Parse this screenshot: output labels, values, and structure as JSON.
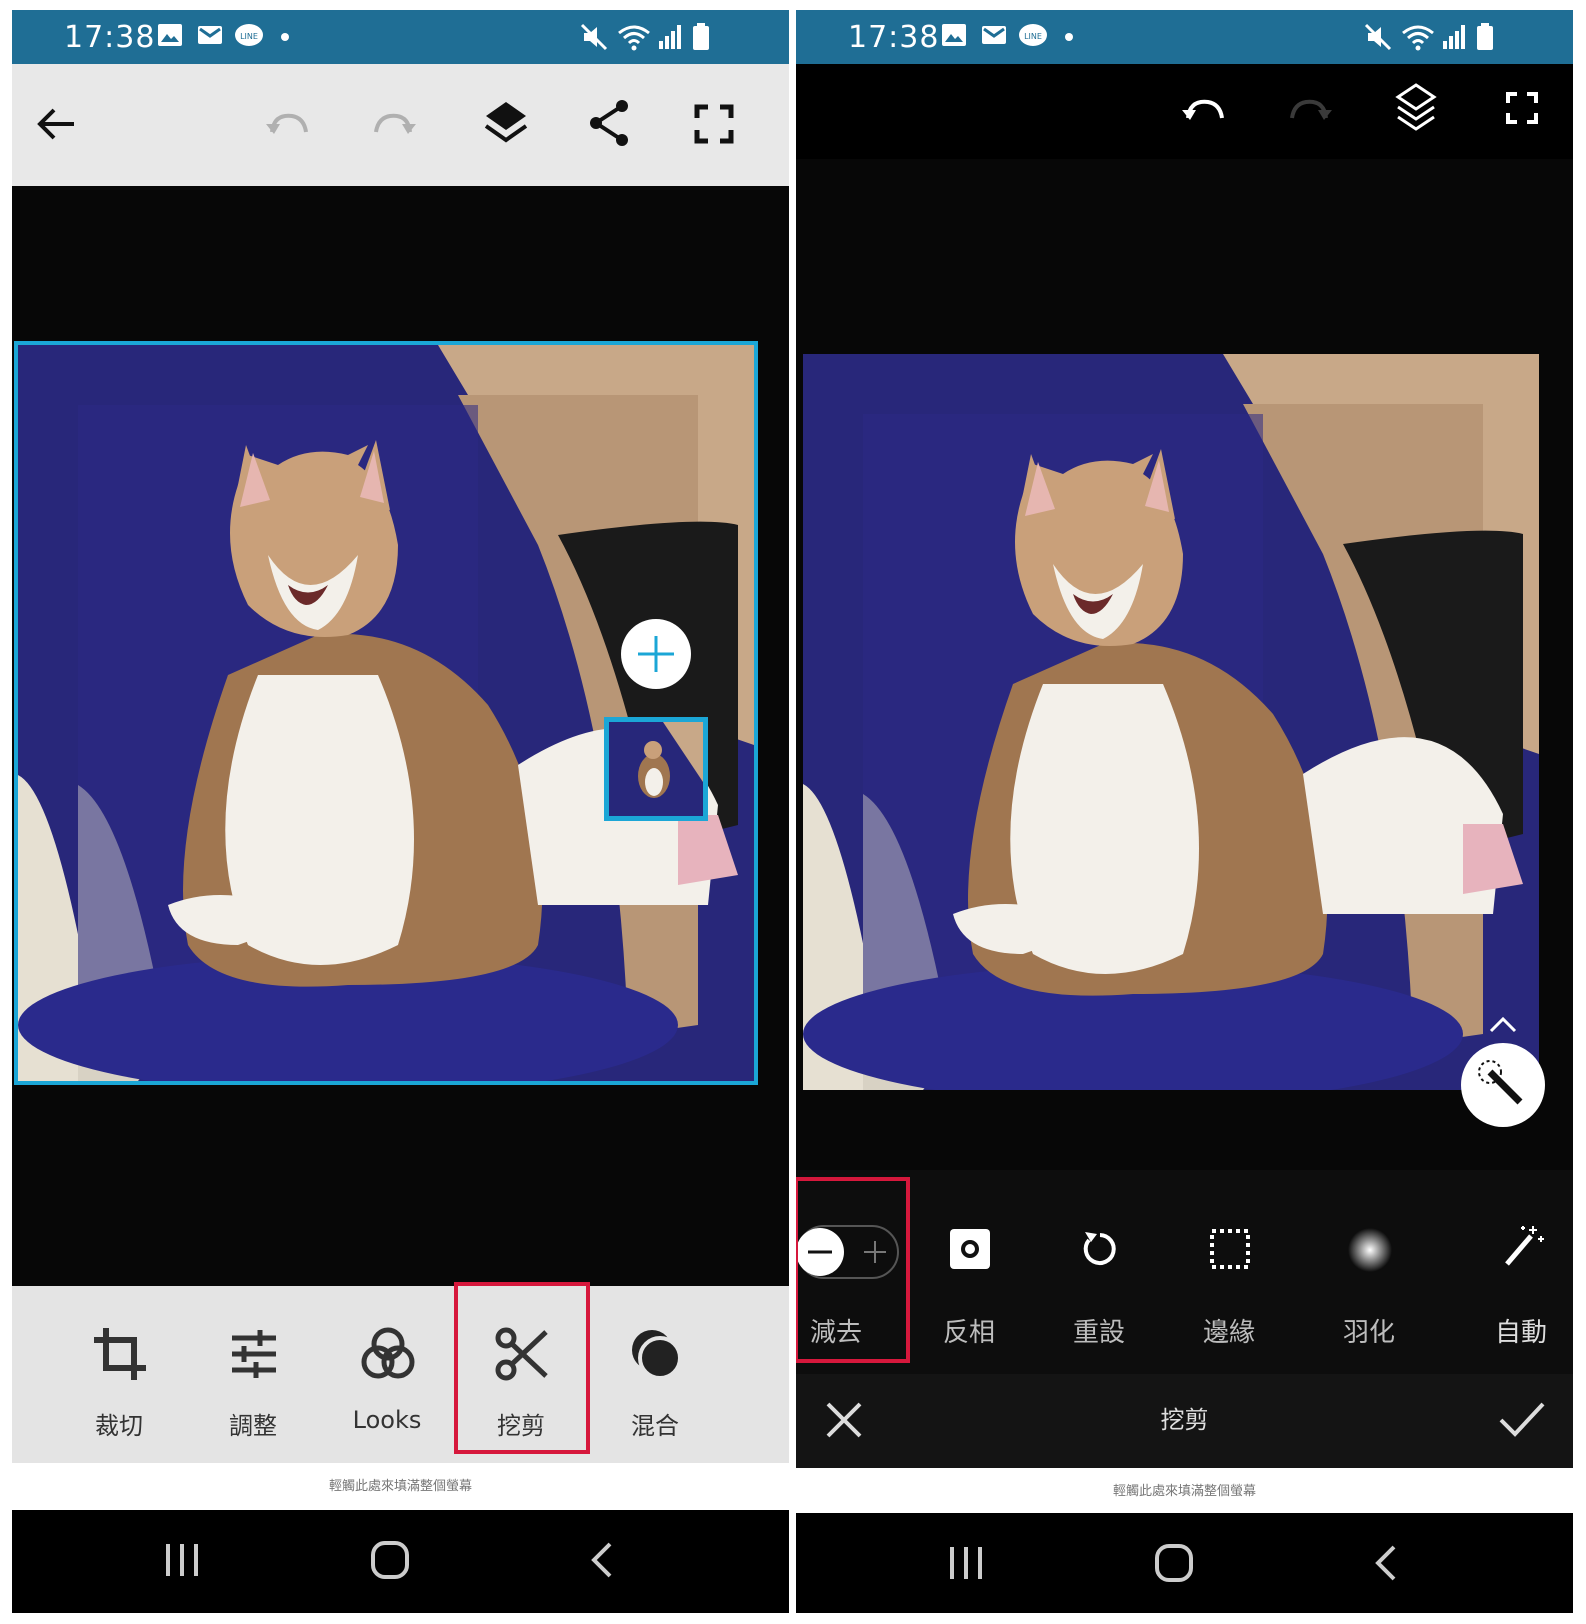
{
  "left": {
    "status": {
      "time": "17:38"
    },
    "tools": [
      {
        "label": "裁切",
        "icon": "crop-icon"
      },
      {
        "label": "調整",
        "icon": "sliders-icon"
      },
      {
        "label": "Looks",
        "icon": "looks-icon"
      },
      {
        "label": "挖剪",
        "icon": "scissors-icon",
        "highlighted": true
      },
      {
        "label": "混合",
        "icon": "blend-icon"
      }
    ],
    "ad_text": "輕觸此處來填滿整個螢幕"
  },
  "right": {
    "status": {
      "time": "17:38"
    },
    "cut_tools": [
      {
        "label": "減去",
        "icon": "subtract-add-toggle",
        "highlighted": true
      },
      {
        "label": "反相",
        "icon": "invert-icon"
      },
      {
        "label": "重設",
        "icon": "reset-icon"
      },
      {
        "label": "邊緣",
        "icon": "edge-icon"
      },
      {
        "label": "羽化",
        "icon": "feather-icon"
      },
      {
        "label": "自動",
        "icon": "auto-wand-icon"
      }
    ],
    "confirm_title": "挖剪",
    "ad_text": "輕觸此處來填滿整個螢幕"
  },
  "colors": {
    "accent": "#1ba6d6",
    "highlight": "#d6183c",
    "statusbar": "#1f6e95"
  }
}
